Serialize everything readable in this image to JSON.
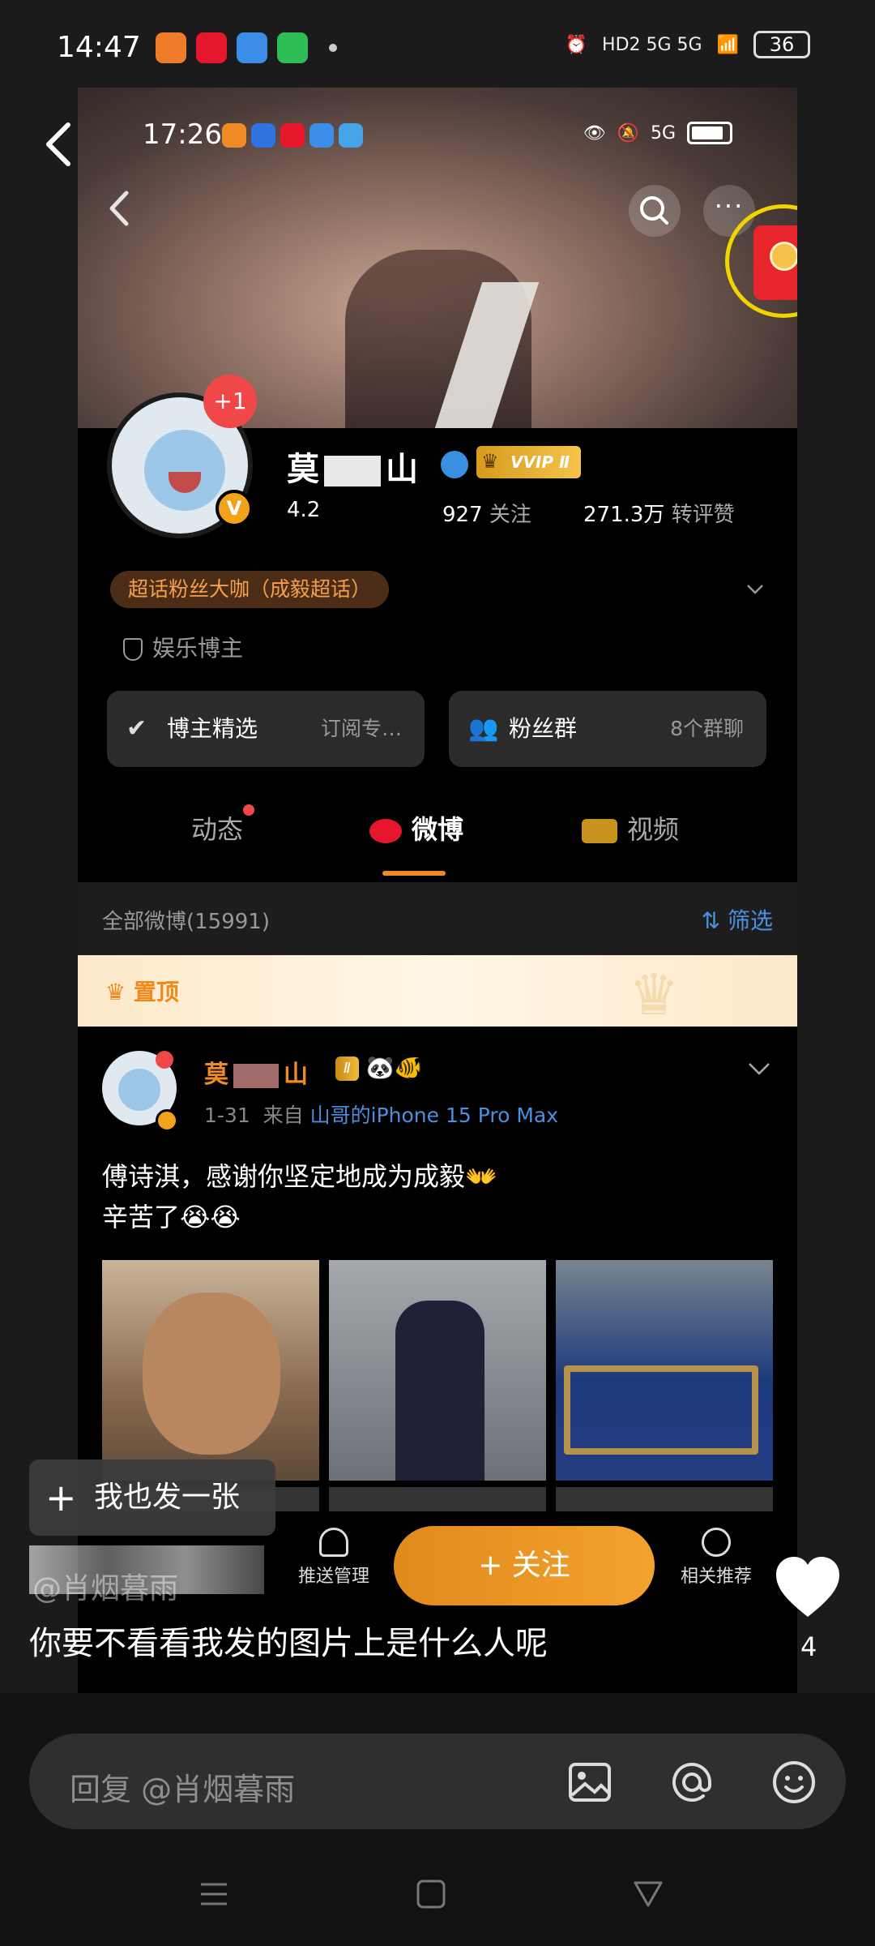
{
  "status_bar": {
    "time": "14:47",
    "apps": [
      "#f07b2a",
      "#e6162d",
      "#3c8de8",
      "#2fbd55"
    ],
    "indicators": "HD2 5G 5G",
    "battery": "36"
  },
  "embedded": {
    "status": {
      "time": "17:26",
      "apps": [
        "#f08a24",
        "#2f73e0",
        "#e6162d",
        "#3c8de8",
        "#48a4e8"
      ],
      "indicators": "5G"
    },
    "profile": {
      "plus_badge": "+1",
      "name_first": "莫",
      "name_last": "山",
      "vip_label": "VVIP Ⅱ",
      "fans": "4.2",
      "follow_count": "927",
      "follow_label": "关注",
      "likes_count": "271.3万",
      "likes_label": "转评赞",
      "super_tag": "超话粉丝大咖（成毅超话）",
      "category": "娱乐博主",
      "card_left_title": "博主精选",
      "card_left_sub": "订阅专…",
      "card_right_title": "粉丝群",
      "card_right_sub": "8个群聊"
    },
    "tabs": {
      "dynamic": "动态",
      "weibo": "微博",
      "video": "视频"
    },
    "filter": {
      "all": "全部微博(15991)",
      "button": "筛选"
    },
    "pinned": "置顶",
    "post": {
      "name_first": "莫",
      "name_last": "山",
      "badge": "Ⅱ",
      "date": "1-31",
      "from_label": "来自",
      "source": "山哥的iPhone 15 Pro Max",
      "line1": "傅诗淇，感谢你坚定地成为成毅👐",
      "line2": "辛苦了😭😭"
    },
    "bottom": {
      "push": "推送管理",
      "follow": "+ 关注",
      "recommend": "相关推荐"
    }
  },
  "overlay": {
    "send_button": "我也发一张",
    "comment_user": "@肖烟暮雨",
    "comment_text": "你要不看看我发的图片上是什么人呢",
    "like_count": "4",
    "reply_placeholder": "回复 @肖烟暮雨"
  }
}
